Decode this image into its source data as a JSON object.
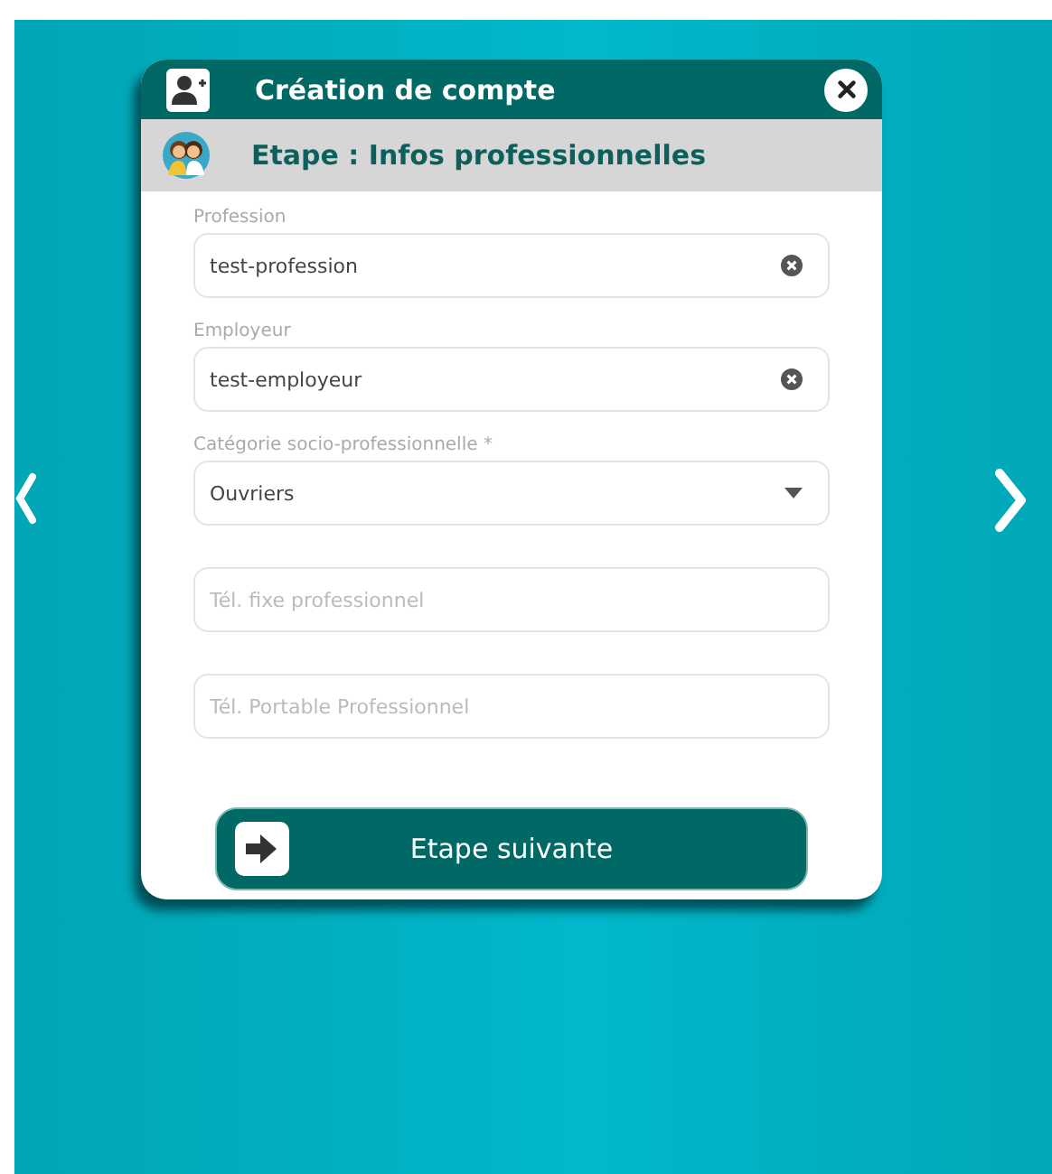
{
  "dialog": {
    "title": "Création de compte",
    "step": "Etape : Infos professionnelles"
  },
  "fields": [
    {
      "kind": "text",
      "label": "Profession",
      "value": "test-profession"
    },
    {
      "kind": "text",
      "label": "Employeur",
      "value": "test-employeur"
    },
    {
      "kind": "select",
      "label": "Catégorie socio-professionnelle *",
      "value": "Ouvriers"
    },
    {
      "kind": "empty",
      "placeholder": "Tél. fixe professionnel"
    },
    {
      "kind": "empty",
      "placeholder": "Tél. Portable Professionnel"
    }
  ],
  "next_button": {
    "label": "Etape suivante"
  }
}
